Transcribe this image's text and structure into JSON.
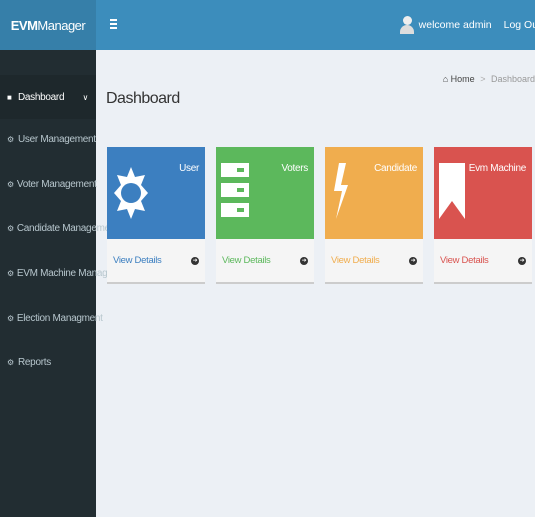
{
  "header": {
    "logo_bold": "EVM",
    "logo_rest": "Manager",
    "welcome": "welcome admin",
    "logout": "Log Out"
  },
  "sidebar": {
    "items": [
      {
        "label": "Dashboard",
        "icon": "dashboard-icon"
      },
      {
        "label": "User Management",
        "icon": "settings-icon"
      },
      {
        "label": "Voter Management",
        "icon": "settings-icon"
      },
      {
        "label": "Candidate Management",
        "icon": "settings-icon"
      },
      {
        "label": "EVM Machine Management",
        "icon": "settings-icon"
      },
      {
        "label": "Election Managment",
        "icon": "settings-icon"
      },
      {
        "label": "Reports",
        "icon": "settings-icon"
      }
    ]
  },
  "breadcrumb": {
    "home": "Home",
    "current": "Dashboard"
  },
  "page": {
    "title": "Dashboard"
  },
  "cards": [
    {
      "title": "User",
      "link": "View Details",
      "color": "#3c7fc0",
      "link_color": "#3c7fc0",
      "icon": "sun-icon"
    },
    {
      "title": "Voters",
      "link": "View Details",
      "color": "#5cb85c",
      "link_color": "#5cb85c",
      "icon": "server-icon"
    },
    {
      "title": "Candidate",
      "link": "View Details",
      "color": "#f0ad4e",
      "link_color": "#f0ad4e",
      "icon": "bolt-icon"
    },
    {
      "title": "Evm Machine",
      "link": "View Details",
      "color": "#d9534f",
      "link_color": "#d9534f",
      "icon": "bookmark-icon"
    }
  ]
}
